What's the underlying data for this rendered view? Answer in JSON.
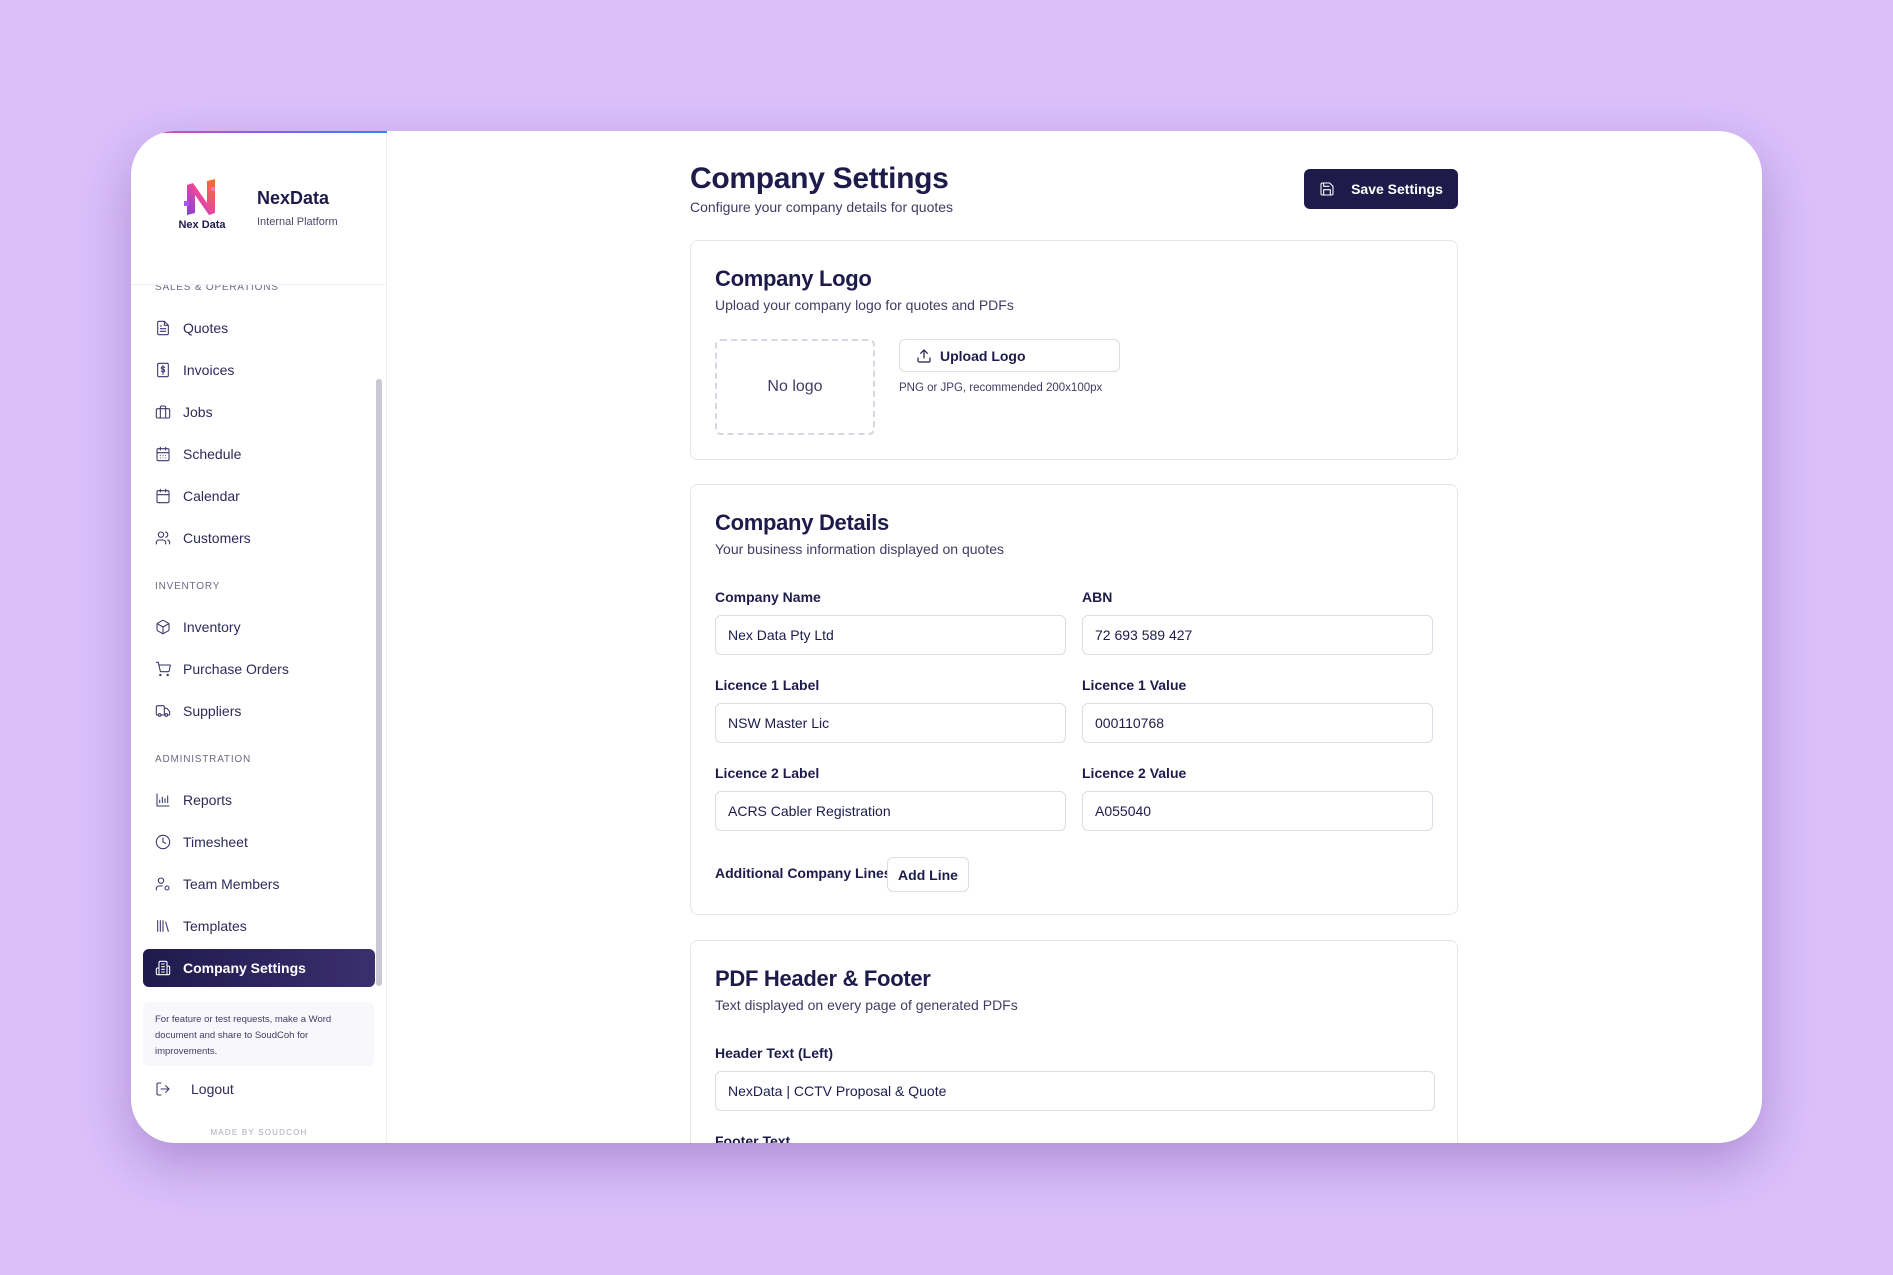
{
  "brand": {
    "logo_text": "Nex Data",
    "name": "NexData",
    "subtitle": "Internal Platform"
  },
  "sidebar": {
    "sections": {
      "sales": "SALES & OPERATIONS",
      "inventory": "INVENTORY",
      "administration": "ADMINISTRATION"
    },
    "items": {
      "quotes": "Quotes",
      "invoices": "Invoices",
      "jobs": "Jobs",
      "schedule": "Schedule",
      "calendar": "Calendar",
      "customers": "Customers",
      "inventory": "Inventory",
      "purchase_orders": "Purchase Orders",
      "suppliers": "Suppliers",
      "reports": "Reports",
      "timesheet": "Timesheet",
      "team_members": "Team Members",
      "templates": "Templates",
      "company_settings": "Company Settings"
    },
    "active_item": "Company Settings",
    "note": "For feature or test requests, make a Word document and share to SoudCoh for improvements.",
    "logout": "Logout",
    "made_by": "MADE BY SOUDCOH"
  },
  "page": {
    "title": "Company Settings",
    "subtitle": "Configure your company details for quotes",
    "save_label": "Save Settings"
  },
  "logo_card": {
    "title": "Company Logo",
    "subtitle": "Upload your company logo for quotes and PDFs",
    "placeholder": "No logo",
    "upload_label": "Upload Logo",
    "hint": "PNG or JPG, recommended 200x100px"
  },
  "details_card": {
    "title": "Company Details",
    "subtitle": "Your business information displayed on quotes",
    "company_name_label": "Company Name",
    "company_name_value": "Nex Data Pty Ltd",
    "abn_label": "ABN",
    "abn_value": "72 693 589 427",
    "licence1_label_label": "Licence 1 Label",
    "licence1_label_value": "NSW Master Lic",
    "licence1_value_label": "Licence 1 Value",
    "licence1_value_value": "000110768",
    "licence2_label_label": "Licence 2 Label",
    "licence2_label_value": "ACRS Cabler Registration",
    "licence2_value_label": "Licence 2 Value",
    "licence2_value_value": "A055040",
    "additional_lines_label": "Additional Company Lines",
    "add_line_label": "Add Line"
  },
  "pdf_card": {
    "title": "PDF Header & Footer",
    "subtitle": "Text displayed on every page of generated PDFs",
    "header_left_label": "Header Text (Left)",
    "header_left_value": "NexData | CCTV Proposal & Quote",
    "footer_label": "Footer Text"
  },
  "colors": {
    "background": "#dabffb",
    "primary": "#1e1b4b",
    "accent_gradient": [
      "#ec4899",
      "#8b5cf6",
      "#3b82f6"
    ]
  }
}
